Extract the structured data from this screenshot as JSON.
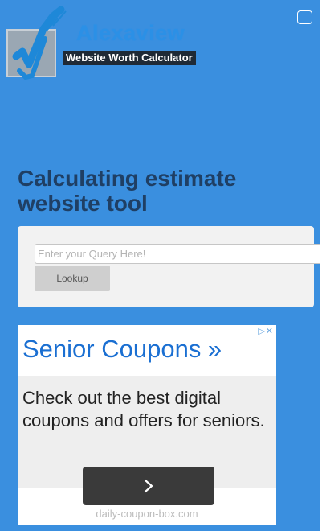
{
  "header": {
    "site_name": "Alexaview",
    "tagline": "Website Worth Calculator"
  },
  "main": {
    "heading": "Calculating estimate website tool",
    "search": {
      "placeholder": "Enter your Query Here!",
      "button_label": "Lookup"
    }
  },
  "ad": {
    "title": "Senior Coupons »",
    "body": "Check out the best digital coupons and offers for seniors.",
    "domain": "daily-coupon-box.com",
    "choices_icon": "adchoices-icon",
    "close_icon": "close-icon",
    "arrow_icon": "chevron-right-icon"
  },
  "colors": {
    "page_background": "#3a8fdf",
    "brand_blue": "#2b90e6",
    "heading": "#1f3f64"
  }
}
